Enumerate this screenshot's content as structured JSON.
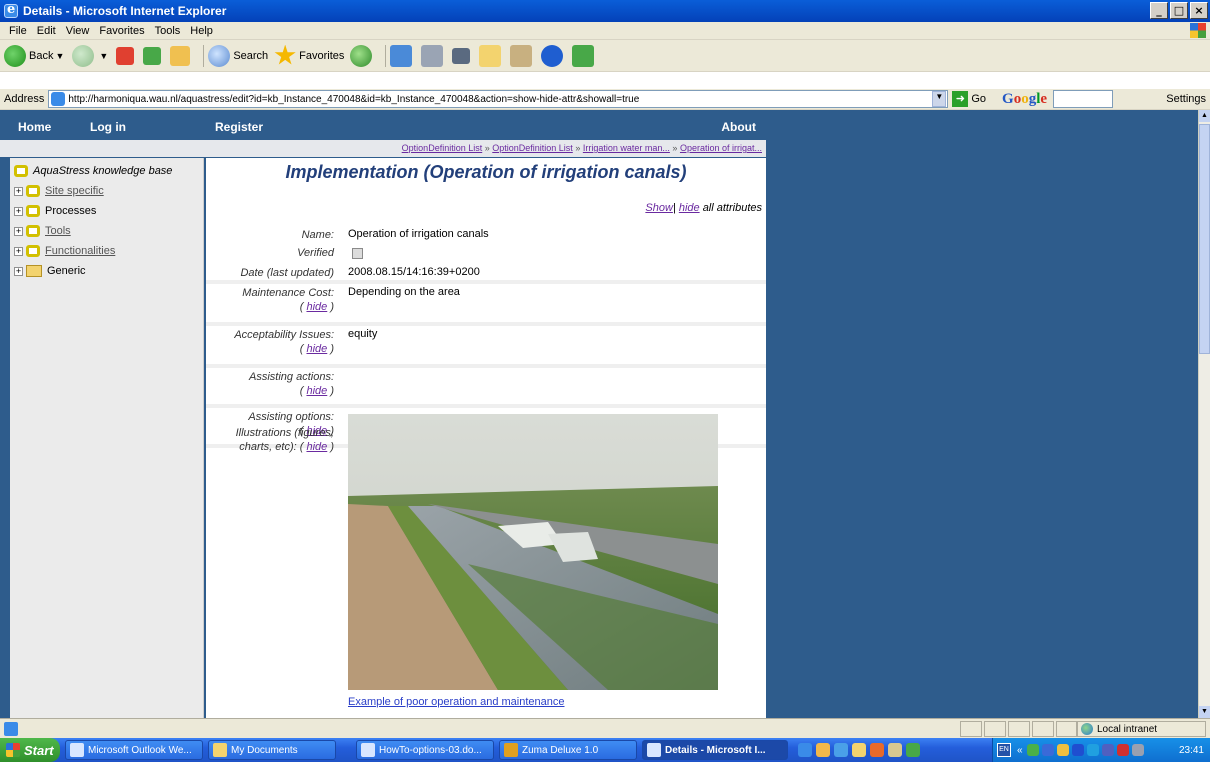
{
  "window": {
    "title": "Details - Microsoft Internet Explorer",
    "buttons": [
      "_",
      "□",
      "×"
    ]
  },
  "menu": [
    "File",
    "Edit",
    "View",
    "Favorites",
    "Tools",
    "Help"
  ],
  "toolbar": {
    "back": "Back",
    "search": "Search",
    "favorites": "Favorites"
  },
  "address": {
    "label": "Address",
    "url": "http://harmoniqua.wau.nl/aquastress/edit?id=kb_Instance_470048&id=kb_Instance_470048&action=show-hide-attr&showall=true",
    "go": "Go",
    "settings": "Settings"
  },
  "nav": {
    "home": "Home",
    "login": "Log in",
    "register": "Register",
    "about": "About"
  },
  "breadcrumbs": [
    "OptionDefinition List",
    "OptionDefinition List",
    "Irrigation water man...",
    "Operation of irrigat..."
  ],
  "breadcrumb_sep": "»",
  "tree": {
    "root": "AquaStress knowledge base",
    "items": [
      "Site specific",
      "Processes",
      "Tools",
      "Functionalities",
      "Generic"
    ]
  },
  "main": {
    "heading": "Implementation (Operation of irrigation canals)",
    "show": "Show",
    "hide": "hide",
    "all_attributes": "all attributes",
    "attributes": {
      "name_label": "Name:",
      "name_value": "Operation of irrigation canals",
      "verified_label": "Verified",
      "date_label": "Date (last updated)",
      "date_value": "2008.08.15/14:16:39+0200",
      "maintenance_label": "Maintenance Cost:",
      "maintenance_value": "Depending on the area",
      "acceptability_label": "Acceptability Issues:",
      "acceptability_value": "equity",
      "assisting_actions_label": "Assisting actions:",
      "assisting_options_label": "Assisting options:",
      "illustrations_label_1": "Illustrations (figures,",
      "illustrations_label_2": "charts, etc): (",
      "hide_link": "hide",
      "paren_open": "(",
      "paren_close": ")"
    },
    "caption": "Example of poor operation and maintenance"
  },
  "status": {
    "zone": "Local intranet"
  },
  "taskbar": {
    "start": "Start",
    "tasks": [
      "Microsoft Outlook We...",
      "My Documents",
      "HowTo-options-03.do...",
      "Zuma Deluxe 1.0",
      "Details - Microsoft I..."
    ],
    "lang": "EN",
    "clock": "23:41"
  }
}
